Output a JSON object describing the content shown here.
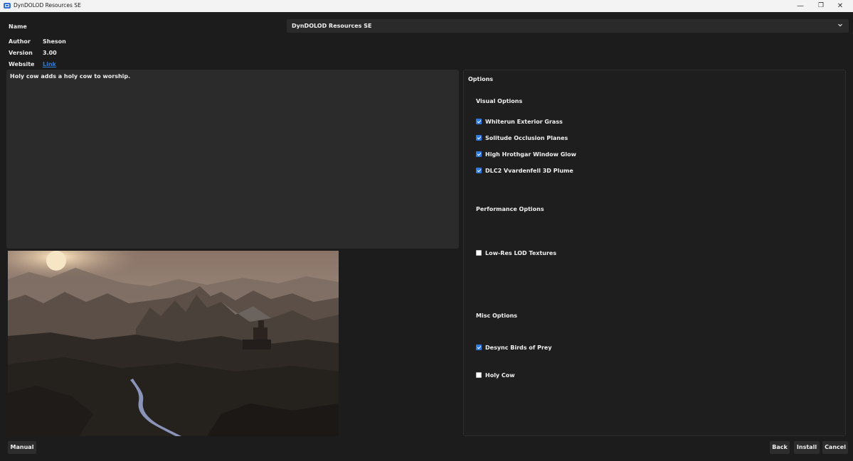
{
  "window": {
    "title": "DynDOLOD Resources SE",
    "minimize_glyph": "—",
    "restore_glyph": "❐",
    "close_glyph": "✕"
  },
  "header": {
    "name_label": "Name",
    "selected_name": "DynDOLOD Resources SE",
    "author_label": "Author",
    "author_value": "Sheson",
    "version_label": "Version",
    "version_value": "3.00",
    "website_label": "Website",
    "website_link_text": "Link"
  },
  "description": {
    "text": "Holy cow adds a holy cow to worship."
  },
  "options": {
    "title": "Options",
    "groups": [
      {
        "title": "Visual Options",
        "items": [
          {
            "label": "Whiterun Exterior Grass",
            "checked": true
          },
          {
            "label": "Solitude Occlusion Planes",
            "checked": true
          },
          {
            "label": "High Hrothgar Window Glow",
            "checked": true
          },
          {
            "label": "DLC2 Vvardenfell 3D Plume",
            "checked": true
          }
        ]
      },
      {
        "title": "Performance Options",
        "items": [
          {
            "label": "Low-Res LOD Textures",
            "checked": false
          }
        ]
      },
      {
        "title": "Misc Options",
        "items": [
          {
            "label": "Desync Birds of Prey",
            "checked": true
          },
          {
            "label": "Holy Cow",
            "checked": false
          }
        ]
      }
    ]
  },
  "buttons": {
    "manual": "Manual",
    "back": "Back",
    "install": "Install",
    "cancel": "Cancel"
  },
  "colors": {
    "background": "#1c1c1c",
    "panel": "#2b2b2b",
    "accent": "#2f7ae0",
    "link": "#2b7bd3"
  },
  "icons": [
    "app-icon",
    "chevron-down-icon",
    "minimize-icon",
    "restore-icon",
    "close-icon",
    "checkbox-checked-icon",
    "checkbox-unchecked-icon"
  ]
}
